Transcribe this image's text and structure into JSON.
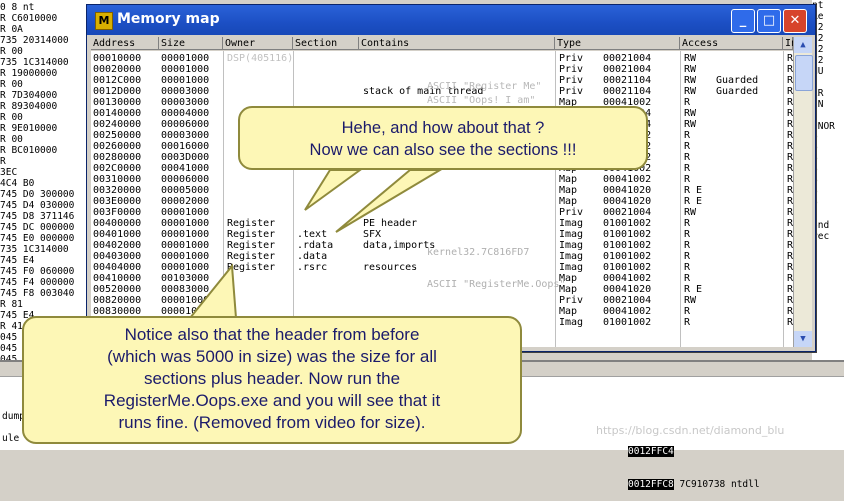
{
  "left_pane_lines": [
    "0 8 nt",
    "R C6010000",
    "R 0A",
    "735 20314000",
    "R 00",
    "735 1C314000",
    "R 19000000",
    "R 00",
    "R 7D304000",
    "R 89304000",
    "R 00",
    "R 9E010000",
    "R 00",
    "R BC010000",
    "R",
    "3EC",
    "4C4 B0",
    "745 D0 300000",
    "745 D4 030000",
    "745 D8 371146",
    "745 DC 000000",
    "745 E0 000000",
    "735 1C314000",
    "745 E4",
    "745 F0 060000",
    "745 F4 000000",
    "745 F8 003040",
    "R 81",
    "745 E4",
    "R 41010000",
    "045 F",
    "045 F",
    "045 F"
  ],
  "right_pane_lines": [
    "nt",
    "Re",
    "32",
    "S2",
    "S2",
    "S2",
    "NU",
    "",
    "ER",
    "(N",
    "",
    "UNOR",
    "0",
    "0",
    "0",
    "0",
    "0",
    "0",
    "0",
    "",
    "ond",
    "rec"
  ],
  "window": {
    "title": "Memory map",
    "minimize_label": "_",
    "maximize_label": "□",
    "close_label": "✕"
  },
  "columns": [
    "Address",
    "Size",
    "Owner",
    "Section",
    "Contains",
    "Type",
    "Access",
    "In"
  ],
  "rows": [
    [
      "00010000",
      "00001000",
      "",
      "",
      "",
      "Priv",
      "00021004",
      "RW",
      ""
    ],
    [
      "00020000",
      "00001000",
      "",
      "",
      "",
      "Priv",
      "00021004",
      "RW",
      ""
    ],
    [
      "0012C000",
      "00001000",
      "",
      "",
      "",
      "Priv",
      "00021104",
      "RW",
      "Guarded"
    ],
    [
      "0012D000",
      "00003000",
      "",
      "",
      "stack of main thread",
      "Priv",
      "00021104",
      "RW",
      "Guarded"
    ],
    [
      "00130000",
      "00003000",
      "",
      "",
      "",
      "Map",
      "00041002",
      "R",
      ""
    ],
    [
      "00140000",
      "00004000",
      "",
      "",
      "",
      "Priv",
      "00021004",
      "RW",
      ""
    ],
    [
      "00240000",
      "00006000",
      "",
      "",
      "",
      "Priv",
      "00021004",
      "RW",
      ""
    ],
    [
      "00250000",
      "00003000",
      "",
      "",
      "",
      "Map",
      "00041002",
      "R",
      ""
    ],
    [
      "00260000",
      "00016000",
      "",
      "",
      "",
      "Map",
      "00041002",
      "R",
      ""
    ],
    [
      "00280000",
      "0003D000",
      "",
      "",
      "",
      "Map",
      "00041002",
      "R",
      ""
    ],
    [
      "002C0000",
      "00041000",
      "",
      "",
      "",
      "Map",
      "00041002",
      "R",
      ""
    ],
    [
      "00310000",
      "00006000",
      "",
      "",
      "",
      "Map",
      "00041002",
      "R",
      ""
    ],
    [
      "00320000",
      "00005000",
      "",
      "",
      "",
      "Map",
      "00041020",
      "R E",
      ""
    ],
    [
      "003E0000",
      "00002000",
      "",
      "",
      "",
      "Map",
      "00041020",
      "R E",
      ""
    ],
    [
      "003F0000",
      "00001000",
      "",
      "",
      "",
      "Priv",
      "00021004",
      "RW",
      ""
    ],
    [
      "00400000",
      "00001000",
      "Register",
      "",
      "PE header",
      "Imag",
      "01001002",
      "R",
      ""
    ],
    [
      "00401000",
      "00001000",
      "Register",
      ".text",
      "SFX",
      "Imag",
      "01001002",
      "R",
      ""
    ],
    [
      "00402000",
      "00001000",
      "Register",
      ".rdata",
      "data,imports",
      "Imag",
      "01001002",
      "R",
      ""
    ],
    [
      "00403000",
      "00001000",
      "Register",
      ".data",
      "",
      "Imag",
      "01001002",
      "R",
      ""
    ],
    [
      "00404000",
      "00001000",
      "Register",
      ".rsrc",
      "resources",
      "Imag",
      "01001002",
      "R",
      ""
    ],
    [
      "00410000",
      "00103000",
      "",
      "",
      "",
      "Map",
      "00041002",
      "R",
      ""
    ],
    [
      "00520000",
      "00083000",
      "",
      "",
      "",
      "Map",
      "00041020",
      "R E",
      ""
    ],
    [
      "00820000",
      "00001000",
      "",
      "",
      "",
      "Priv",
      "00021004",
      "RW",
      ""
    ],
    [
      "00830000",
      "00001000",
      "",
      "",
      "",
      "Map",
      "00041002",
      "R",
      ""
    ],
    [
      "00840000",
      "00001000",
      "",
      "",
      "",
      "Imag",
      "01001002",
      "R",
      ""
    ]
  ],
  "ghost_texts": [
    "DSP(405116)",
    "ASCII \"Register Me\"",
    "ASCII \"Oops! I am\"",
    "kernel32.7C816FD7",
    "ASCII \"RegisterMe.Oops\""
  ],
  "callouts": {
    "top": [
      "Hehe, and how about that ?",
      "Now we can also see the sections !!!"
    ],
    "bottom": [
      "Notice also that the header from before",
      "(which was 5000 in size) was the size for all",
      "sections plus header. Now run the",
      "RegisterMe.Oops.exe and you will see that it",
      "runs fine. (Removed from video for size)."
    ]
  },
  "bottom_pane": {
    "label_1": "dump",
    "label_2": "ule",
    "stack_rows": [
      [
        "0012FFC4",
        ""
      ],
      [
        "0012FFC8",
        "7C910738 ntdll"
      ]
    ],
    "watermark": "https://blog.csdn.net/diamond_blu"
  },
  "colors": {
    "titlebar": "#1c4fc4",
    "callout_fill": "#fdf7b6",
    "callout_border": "#8f8a3c",
    "callout_text": "#1b1b6b"
  }
}
